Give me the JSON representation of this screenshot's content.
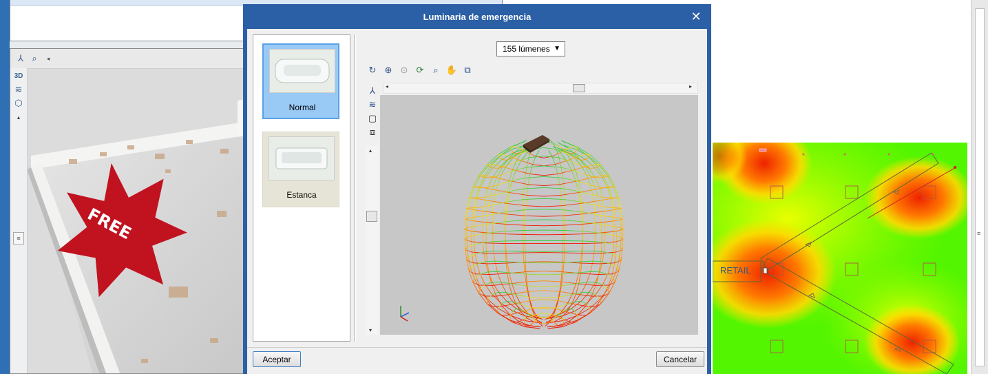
{
  "dialog": {
    "title": "Luminaria de emergencia",
    "close_glyph": "✕",
    "lumen_select": {
      "value": "155 lúmenes"
    },
    "luminaires": [
      {
        "label": "Normal",
        "selected": true
      },
      {
        "label": "Estanca",
        "selected": false
      }
    ],
    "buttons": {
      "ok": "Aceptar",
      "cancel": "Cancelar"
    },
    "viewer_tools": [
      "rotate-icon",
      "zoom-all-icon",
      "zoom-x2-icon",
      "refresh-icon",
      "zoom-window-icon",
      "pan-hand-icon",
      "fit-view-icon"
    ],
    "viewer_side_tools": [
      "axes-icon",
      "layers-icon",
      "box-icon",
      "views-icon"
    ]
  },
  "left_view": {
    "badge": "FREE",
    "tools": [
      "axes-icon",
      "zoom-window-icon",
      "3d-icon",
      "layers-icon",
      "box-icon"
    ]
  },
  "plan": {
    "room_label": "RETAIL"
  },
  "colors": {
    "title_bar": "#2b5fa6",
    "badge_red": "#c1121f",
    "selection_blue": "#99c9f5",
    "mesh_green": "#2ecc40",
    "mesh_yellow": "#f0e020",
    "mesh_red": "#ee1100"
  }
}
